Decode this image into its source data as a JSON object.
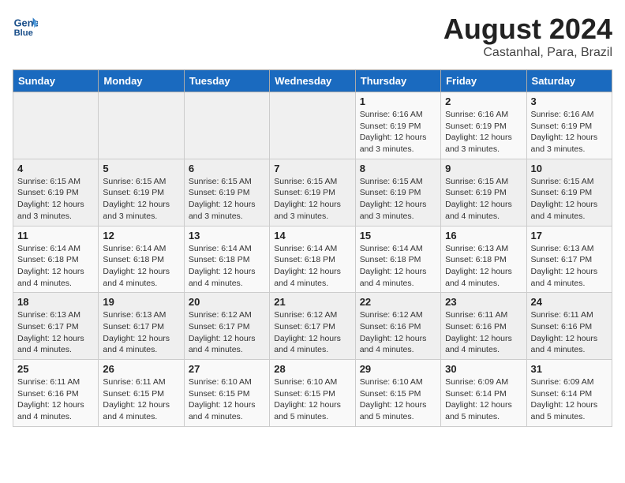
{
  "header": {
    "logo_line1": "General",
    "logo_line2": "Blue",
    "title": "August 2024",
    "subtitle": "Castanhal, Para, Brazil"
  },
  "columns": [
    "Sunday",
    "Monday",
    "Tuesday",
    "Wednesday",
    "Thursday",
    "Friday",
    "Saturday"
  ],
  "weeks": [
    [
      {
        "day": "",
        "info": ""
      },
      {
        "day": "",
        "info": ""
      },
      {
        "day": "",
        "info": ""
      },
      {
        "day": "",
        "info": ""
      },
      {
        "day": "1",
        "info": "Sunrise: 6:16 AM\nSunset: 6:19 PM\nDaylight: 12 hours and 3 minutes."
      },
      {
        "day": "2",
        "info": "Sunrise: 6:16 AM\nSunset: 6:19 PM\nDaylight: 12 hours and 3 minutes."
      },
      {
        "day": "3",
        "info": "Sunrise: 6:16 AM\nSunset: 6:19 PM\nDaylight: 12 hours and 3 minutes."
      }
    ],
    [
      {
        "day": "4",
        "info": "Sunrise: 6:15 AM\nSunset: 6:19 PM\nDaylight: 12 hours and 3 minutes."
      },
      {
        "day": "5",
        "info": "Sunrise: 6:15 AM\nSunset: 6:19 PM\nDaylight: 12 hours and 3 minutes."
      },
      {
        "day": "6",
        "info": "Sunrise: 6:15 AM\nSunset: 6:19 PM\nDaylight: 12 hours and 3 minutes."
      },
      {
        "day": "7",
        "info": "Sunrise: 6:15 AM\nSunset: 6:19 PM\nDaylight: 12 hours and 3 minutes."
      },
      {
        "day": "8",
        "info": "Sunrise: 6:15 AM\nSunset: 6:19 PM\nDaylight: 12 hours and 3 minutes."
      },
      {
        "day": "9",
        "info": "Sunrise: 6:15 AM\nSunset: 6:19 PM\nDaylight: 12 hours and 4 minutes."
      },
      {
        "day": "10",
        "info": "Sunrise: 6:15 AM\nSunset: 6:19 PM\nDaylight: 12 hours and 4 minutes."
      }
    ],
    [
      {
        "day": "11",
        "info": "Sunrise: 6:14 AM\nSunset: 6:18 PM\nDaylight: 12 hours and 4 minutes."
      },
      {
        "day": "12",
        "info": "Sunrise: 6:14 AM\nSunset: 6:18 PM\nDaylight: 12 hours and 4 minutes."
      },
      {
        "day": "13",
        "info": "Sunrise: 6:14 AM\nSunset: 6:18 PM\nDaylight: 12 hours and 4 minutes."
      },
      {
        "day": "14",
        "info": "Sunrise: 6:14 AM\nSunset: 6:18 PM\nDaylight: 12 hours and 4 minutes."
      },
      {
        "day": "15",
        "info": "Sunrise: 6:14 AM\nSunset: 6:18 PM\nDaylight: 12 hours and 4 minutes."
      },
      {
        "day": "16",
        "info": "Sunrise: 6:13 AM\nSunset: 6:18 PM\nDaylight: 12 hours and 4 minutes."
      },
      {
        "day": "17",
        "info": "Sunrise: 6:13 AM\nSunset: 6:17 PM\nDaylight: 12 hours and 4 minutes."
      }
    ],
    [
      {
        "day": "18",
        "info": "Sunrise: 6:13 AM\nSunset: 6:17 PM\nDaylight: 12 hours and 4 minutes."
      },
      {
        "day": "19",
        "info": "Sunrise: 6:13 AM\nSunset: 6:17 PM\nDaylight: 12 hours and 4 minutes."
      },
      {
        "day": "20",
        "info": "Sunrise: 6:12 AM\nSunset: 6:17 PM\nDaylight: 12 hours and 4 minutes."
      },
      {
        "day": "21",
        "info": "Sunrise: 6:12 AM\nSunset: 6:17 PM\nDaylight: 12 hours and 4 minutes."
      },
      {
        "day": "22",
        "info": "Sunrise: 6:12 AM\nSunset: 6:16 PM\nDaylight: 12 hours and 4 minutes."
      },
      {
        "day": "23",
        "info": "Sunrise: 6:11 AM\nSunset: 6:16 PM\nDaylight: 12 hours and 4 minutes."
      },
      {
        "day": "24",
        "info": "Sunrise: 6:11 AM\nSunset: 6:16 PM\nDaylight: 12 hours and 4 minutes."
      }
    ],
    [
      {
        "day": "25",
        "info": "Sunrise: 6:11 AM\nSunset: 6:16 PM\nDaylight: 12 hours and 4 minutes."
      },
      {
        "day": "26",
        "info": "Sunrise: 6:11 AM\nSunset: 6:15 PM\nDaylight: 12 hours and 4 minutes."
      },
      {
        "day": "27",
        "info": "Sunrise: 6:10 AM\nSunset: 6:15 PM\nDaylight: 12 hours and 4 minutes."
      },
      {
        "day": "28",
        "info": "Sunrise: 6:10 AM\nSunset: 6:15 PM\nDaylight: 12 hours and 5 minutes."
      },
      {
        "day": "29",
        "info": "Sunrise: 6:10 AM\nSunset: 6:15 PM\nDaylight: 12 hours and 5 minutes."
      },
      {
        "day": "30",
        "info": "Sunrise: 6:09 AM\nSunset: 6:14 PM\nDaylight: 12 hours and 5 minutes."
      },
      {
        "day": "31",
        "info": "Sunrise: 6:09 AM\nSunset: 6:14 PM\nDaylight: 12 hours and 5 minutes."
      }
    ]
  ]
}
